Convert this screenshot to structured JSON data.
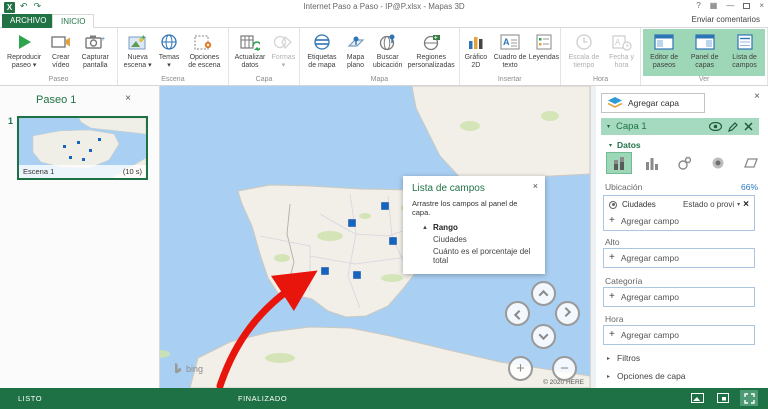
{
  "titlebar": {
    "title": "Internet Paso a Paso - IP@P.xlsx - Mapas 3D",
    "feedback": "Enviar comentarios"
  },
  "tabs": {
    "archivo": "ARCHIVO",
    "inicio": "INICIO"
  },
  "icons": {
    "undo": "↶",
    "redo": "↷",
    "help": "?",
    "ribbon_options": "▦",
    "minimize": "—",
    "close": "×",
    "caret_down": "▾",
    "caret_right": "▸",
    "collapse_up": "▲",
    "plus": "+",
    "minus": "−",
    "pencil": "✎",
    "bing_b": "b"
  },
  "ribbon": {
    "paseo": {
      "label": "Paseo",
      "play": "Reproducir paseo ▾",
      "video": "Crear vídeo",
      "screenshot": "Capturar pantalla"
    },
    "escena": {
      "label": "Escena",
      "nueva": "Nueva escena ▾",
      "temas": "Temas ▾",
      "opciones": "Opciones de escena"
    },
    "capa": {
      "label": "Capa",
      "actualizar": "Actualizar datos",
      "formas": "Formas ▾"
    },
    "mapa": {
      "label": "Mapa",
      "etiquetas": "Etiquetas de mapa",
      "plano": "Mapa plano",
      "buscar": "Buscar ubicación",
      "regiones": "Regiones personalizadas"
    },
    "insertar": {
      "label": "Insertar",
      "grafico": "Gráfico 2D",
      "cuadro": "Cuadro de texto",
      "leyendas": "Leyendas"
    },
    "hora": {
      "label": "Hora",
      "escala": "Escala de tiempo",
      "fecha": "Fecha y hora"
    },
    "ver": {
      "label": "Ver",
      "editor": "Editor de paseos",
      "panel": "Panel de capas",
      "lista": "Lista de campos"
    }
  },
  "tour": {
    "title": "Paseo 1",
    "number": "1",
    "scene": "Escena 1",
    "duration": "(10 s)"
  },
  "fields_panel": {
    "title": "Lista de campos",
    "hint": "Arrastre los campos al panel de capa.",
    "group": "Rango",
    "field1": "Ciudades",
    "field2": "Cuánto es el porcentaje del total"
  },
  "layer_panel": {
    "add_layer": "Agregar capa",
    "name": "Capa 1",
    "datos": "Datos",
    "ubicacion": "Ubicación",
    "percent": "66%",
    "location_field": "Ciudades",
    "location_type": "Estado o provi",
    "add_field": "Agregar campo",
    "alto": "Alto",
    "categoria": "Categoría",
    "hora": "Hora",
    "filtros": "Filtros",
    "opciones": "Opciones de capa"
  },
  "map": {
    "bing": "bing",
    "copyright": "© 2020 HERE"
  },
  "statusbar": {
    "left": "LISTO",
    "center": "FINALIZADO"
  },
  "colors": {
    "accent": "#217346",
    "ribbon_highlight": "#9ed7b7",
    "water": "#a9cff2",
    "land": "#f2efe9",
    "marker": "#1565c0",
    "arrow": "#e8150d",
    "link": "#2779c4",
    "statusbar": "#1e7145"
  }
}
